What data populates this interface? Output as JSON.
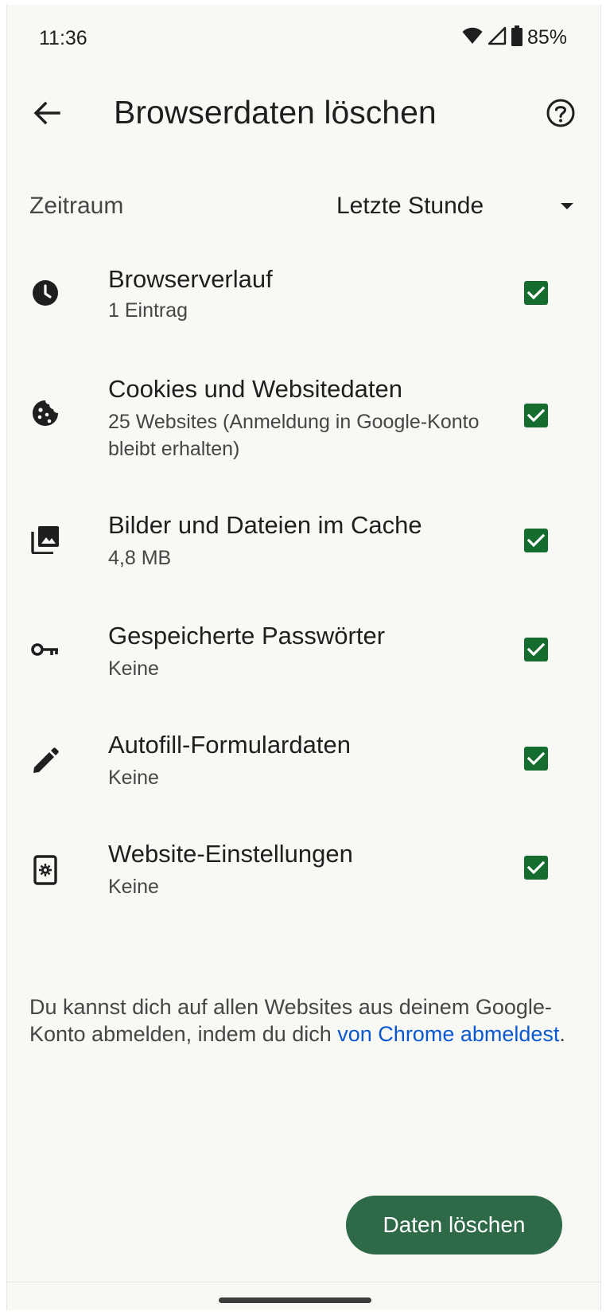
{
  "status_bar": {
    "time": "11:36",
    "battery": "85%",
    "icons": [
      "wifi-icon",
      "signal-icon",
      "battery-icon"
    ]
  },
  "app_bar": {
    "title": "Browserdaten löschen",
    "back_icon": "arrow-back-icon",
    "help_icon": "help-circle-icon"
  },
  "time_range": {
    "label": "Zeitraum",
    "selected": "Letzte Stunde"
  },
  "items": [
    {
      "icon": "history-clock-icon",
      "title": "Browserverlauf",
      "subtitle": "1 Eintrag",
      "checked": true
    },
    {
      "icon": "cookie-icon",
      "title": "Cookies und Websitedaten",
      "subtitle": "25 Websites (Anmeldung in Google-Konto bleibt erhalten)",
      "checked": true
    },
    {
      "icon": "image-stack-icon",
      "title": "Bilder und Dateien im Cache",
      "subtitle": "4,8 MB",
      "checked": true
    },
    {
      "icon": "key-icon",
      "title": "Gespeicherte Passwörter",
      "subtitle": "Keine",
      "checked": true
    },
    {
      "icon": "pencil-icon",
      "title": "Autofill-Formulardaten",
      "subtitle": "Keine",
      "checked": true
    },
    {
      "icon": "site-settings-icon",
      "title": "Website-Einstellungen",
      "subtitle": "Keine",
      "checked": true
    }
  ],
  "footer": {
    "text": "Du kannst dich auf allen Websites aus deinem Google-Konto abmelden, indem du dich ",
    "link": "von Chrome abmeldest",
    "suffix": "."
  },
  "primary_button": {
    "label": "Daten löschen"
  },
  "colors": {
    "background": "#f8f9f5",
    "checkbox": "#146c2e",
    "button": "#2e6a48",
    "link": "#0b57d0"
  }
}
